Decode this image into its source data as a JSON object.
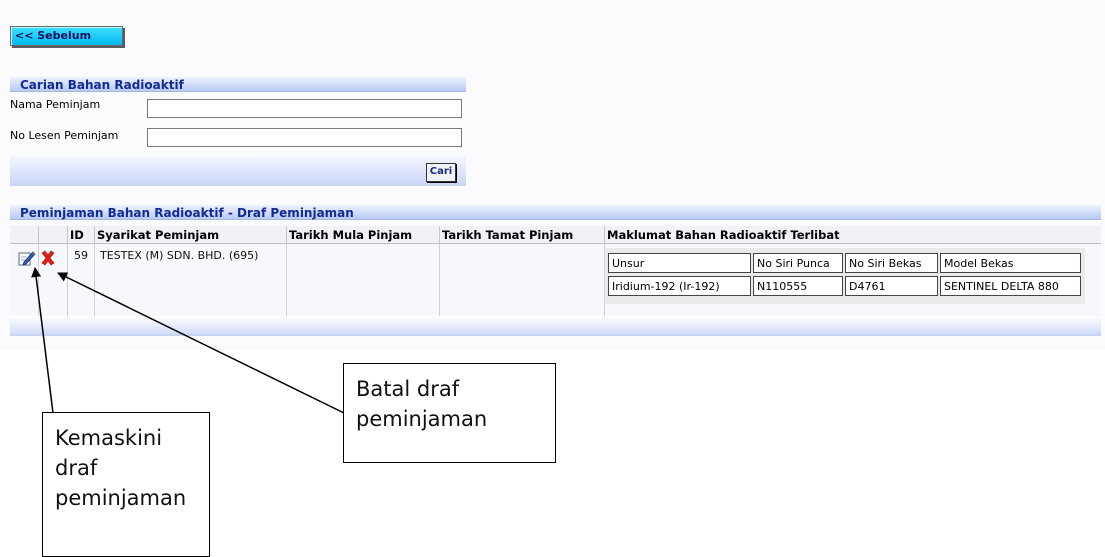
{
  "nav": {
    "back_label": "<< Sebelum"
  },
  "search": {
    "title": "Carian Bahan Radioaktif",
    "borrower_name_label": "Nama Peminjam",
    "borrower_name_value": "",
    "license_label": "No Lesen Peminjam",
    "license_value": "",
    "button_label": "Cari"
  },
  "results": {
    "title": "Peminjaman Bahan Radioaktif - Draf Peminjaman",
    "columns": [
      "ID",
      "Syarikat Peminjam",
      "Tarikh Mula Pinjam",
      "Tarikh Tamat Pinjam",
      "Maklumat Bahan Radioaktif Terlibat"
    ],
    "rows": [
      {
        "id": "59",
        "company": "TESTEX (M) SDN. BHD. (695)",
        "start_date": "",
        "end_date": "",
        "materials": {
          "headers": [
            "Unsur",
            "No Siri Punca",
            "No Siri Bekas",
            "Model Bekas"
          ],
          "values": [
            "Iridium-192 (Ir-192)",
            "N110555",
            "D4761",
            "SENTINEL DELTA 880"
          ]
        }
      }
    ]
  },
  "annotations": {
    "cancel_note": "Batal draf peminjaman",
    "edit_note": "Kemaskini draf peminjaman"
  },
  "icons": {
    "edit": "pencil-edit-icon",
    "delete": "red-x-delete-icon"
  },
  "colors": {
    "panel_title": "#132c95",
    "back_button": "#00c8f8",
    "delete_icon": "#e02010"
  }
}
